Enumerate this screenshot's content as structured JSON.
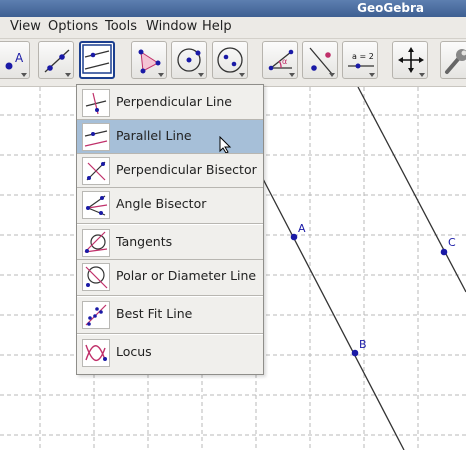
{
  "app": {
    "title": "GeoGebra"
  },
  "menubar": {
    "items": [
      "View",
      "Options",
      "Tools",
      "Window",
      "Help"
    ]
  },
  "toolbar": {
    "tools": [
      {
        "icon": "point-icon"
      },
      {
        "icon": "line-through-points-icon"
      },
      {
        "icon": "parallel-line-tool-icon",
        "selected": true
      },
      {
        "icon": "polygon-icon"
      },
      {
        "icon": "circle-center-point-icon"
      },
      {
        "icon": "ellipse-icon"
      },
      {
        "icon": "angle-icon"
      },
      {
        "icon": "reflect-icon"
      },
      {
        "icon": "slider-icon",
        "label": "a = 2"
      },
      {
        "icon": "move-graphics-view-icon"
      },
      {
        "icon": "wrench-icon"
      }
    ]
  },
  "dropdown": {
    "items": [
      {
        "label": "Perpendicular Line",
        "icon": "perpendicular-line-icon"
      },
      {
        "label": "Parallel Line",
        "icon": "parallel-line-icon",
        "highlighted": true
      },
      {
        "label": "Perpendicular Bisector",
        "icon": "perpendicular-bisector-icon"
      },
      {
        "label": "Angle Bisector",
        "icon": "angle-bisector-icon"
      },
      {
        "label": "Tangents",
        "icon": "tangents-icon"
      },
      {
        "label": "Polar or Diameter Line",
        "icon": "polar-line-icon"
      },
      {
        "label": "Best Fit Line",
        "icon": "best-fit-line-icon"
      },
      {
        "label": "Locus",
        "icon": "locus-icon"
      }
    ]
  },
  "canvas": {
    "points": [
      {
        "label": "A"
      },
      {
        "label": "B"
      },
      {
        "label": "C"
      }
    ]
  },
  "colors": {
    "accent": "#1c3f8f",
    "point": "#1a1aa6",
    "highlight": "#a6bfd8"
  }
}
